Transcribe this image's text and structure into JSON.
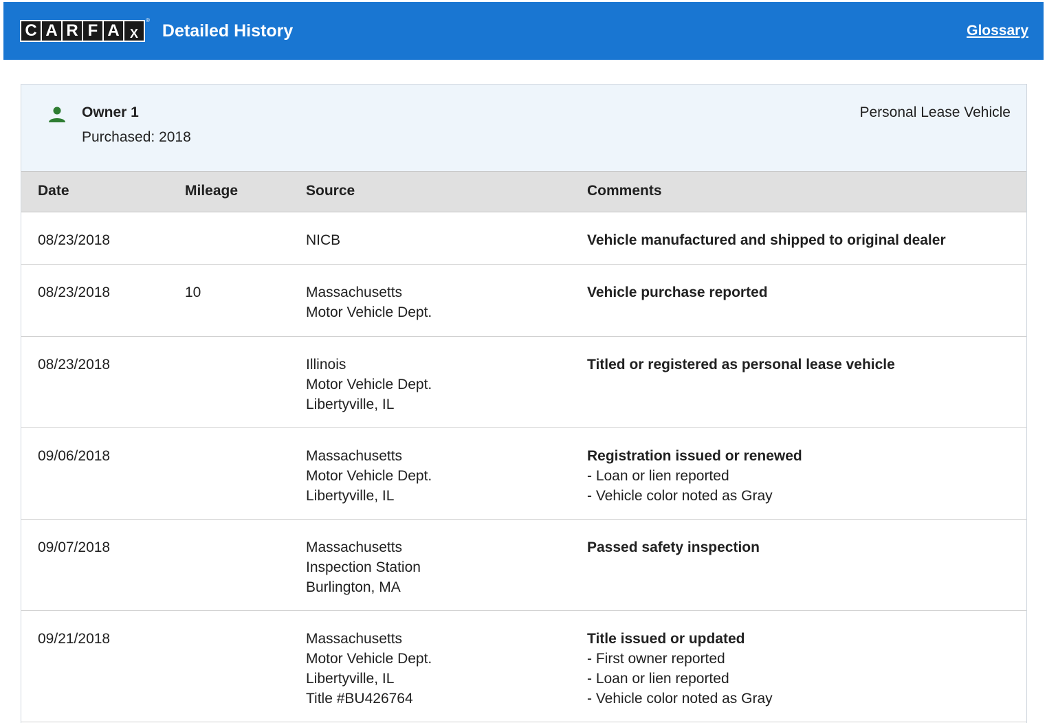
{
  "header": {
    "logo_letters": [
      "C",
      "A",
      "R",
      "F",
      "A",
      "X"
    ],
    "logo_tm": "®",
    "title": "Detailed History",
    "glossary_link": "Glossary"
  },
  "owner": {
    "name": "Owner 1",
    "purchased": "Purchased: 2018",
    "type": "Personal Lease Vehicle",
    "icon": "person-icon",
    "icon_color": "#2e7d32"
  },
  "table": {
    "headers": {
      "date": "Date",
      "mileage": "Mileage",
      "source": "Source",
      "comments": "Comments"
    },
    "rows": [
      {
        "date": "08/23/2018",
        "mileage": "",
        "source": [
          "NICB"
        ],
        "comment_title": "Vehicle manufactured and shipped to original dealer",
        "comment_details": []
      },
      {
        "date": "08/23/2018",
        "mileage": "10",
        "source": [
          "Massachusetts",
          "Motor Vehicle Dept."
        ],
        "comment_title": "Vehicle purchase reported",
        "comment_details": []
      },
      {
        "date": "08/23/2018",
        "mileage": "",
        "source": [
          "Illinois",
          "Motor Vehicle Dept.",
          "Libertyville, IL"
        ],
        "comment_title": "Titled or registered as personal lease vehicle",
        "comment_details": []
      },
      {
        "date": "09/06/2018",
        "mileage": "",
        "source": [
          "Massachusetts",
          "Motor Vehicle Dept.",
          "Libertyville, IL"
        ],
        "comment_title": "Registration issued or renewed",
        "comment_details": [
          "- Loan or lien reported",
          "- Vehicle color noted as Gray"
        ]
      },
      {
        "date": "09/07/2018",
        "mileage": "",
        "source": [
          "Massachusetts",
          "Inspection Station",
          "Burlington, MA"
        ],
        "comment_title": "Passed safety inspection",
        "comment_details": []
      },
      {
        "date": "09/21/2018",
        "mileage": "",
        "source": [
          "Massachusetts",
          "Motor Vehicle Dept.",
          "Libertyville, IL",
          "Title #BU426764"
        ],
        "comment_title": "Title issued or updated",
        "comment_details": [
          "- First owner reported",
          "- Loan or lien reported",
          "- Vehicle color noted as Gray"
        ]
      }
    ]
  },
  "colors": {
    "header_bg": "#1976d2",
    "owner_band_bg": "#eef5fb",
    "table_header_bg": "#e0e0e0"
  }
}
